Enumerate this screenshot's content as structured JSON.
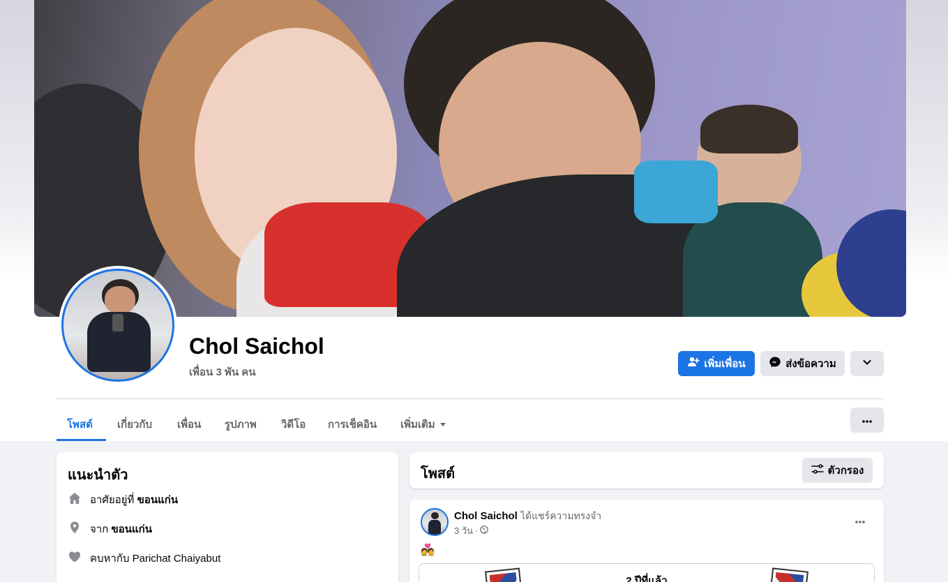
{
  "profile": {
    "name": "Chol Saichol",
    "friends": "เพื่อน 3 พัน คน"
  },
  "actions": {
    "add_friend": "เพิ่มเพื่อน",
    "message": "ส่งข้อความ"
  },
  "tabs": [
    {
      "label": "โพสต์",
      "active": true
    },
    {
      "label": "เกี่ยวกับ"
    },
    {
      "label": "เพื่อน"
    },
    {
      "label": "รูปภาพ"
    },
    {
      "label": "วิดีโอ"
    },
    {
      "label": "การเช็คอิน"
    },
    {
      "label": "เพิ่มเติม"
    }
  ],
  "intro": {
    "title": "แนะนำตัว",
    "lives_prefix": "อาศัยอยู่ที่",
    "lives_place": "ขอนแก่น",
    "from_prefix": "จาก",
    "from_place": "ขอนแก่น",
    "relationship": "คบหากับ Parichat Chaiyabut"
  },
  "posts": {
    "title": "โพสต์",
    "filter": "ตัวกรอง"
  },
  "post": {
    "author": "Chol Saichol",
    "action": "ได้แชร์ความทรงจำ",
    "time": "3 วัน",
    "emoji": "💑",
    "memory_years": "2 ปีที่แล้ว"
  },
  "colors": {
    "accent": "#1b74e4",
    "background": "#f0f2f5",
    "secondary_button": "#e4e6eb"
  }
}
